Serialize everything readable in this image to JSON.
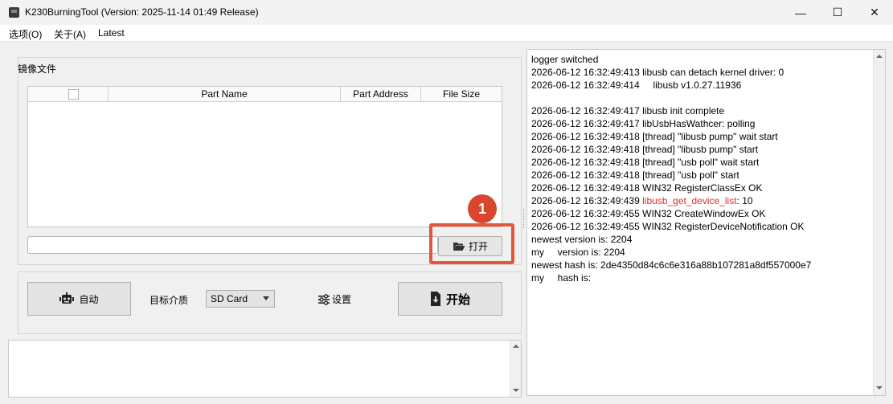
{
  "window": {
    "title": "K230BurningTool (Version: 2025-11-14 01:49 Release)",
    "minimize": "—",
    "maximize": "☐",
    "close": "✕"
  },
  "menu": [
    {
      "label": "选项(O)"
    },
    {
      "label": "关于(A)"
    },
    {
      "label": "Latest"
    }
  ],
  "image_group": {
    "title": "镜像文件",
    "columns": [
      "",
      "Part Name",
      "Part Address",
      "File Size"
    ],
    "path_value": "",
    "open_button": "打开",
    "annotation_number": "1"
  },
  "actions": {
    "auto_button": "自动",
    "target_label": "目标介质",
    "target_value": "SD Card",
    "settings_button": "设置",
    "start_button": "开始"
  },
  "log": [
    {
      "text": "logger switched"
    },
    {
      "text": "2026-06-12 16:32:49:413 libusb can detach kernel driver: 0"
    },
    {
      "text": "2026-06-12 16:32:49:414     libusb v1.0.27.11936"
    },
    {
      "text": ""
    },
    {
      "text": "2026-06-12 16:32:49:417 libusb init complete"
    },
    {
      "text": "2026-06-12 16:32:49:417 libUsbHasWathcer: polling"
    },
    {
      "text": "2026-06-12 16:32:49:418 [thread] \"libusb pump\" wait start"
    },
    {
      "text": "2026-06-12 16:32:49:418 [thread] \"libusb pump\" start"
    },
    {
      "text": "2026-06-12 16:32:49:418 [thread] \"usb poll\" wait start"
    },
    {
      "text": "2026-06-12 16:32:49:418 [thread] \"usb poll\" start"
    },
    {
      "text": "2026-06-12 16:32:49:418 WIN32 RegisterClassEx OK"
    },
    {
      "prefix": "2026-06-12 16:32:49:439 ",
      "error": "libusb_get_device_list",
      "suffix": ": 10"
    },
    {
      "text": "2026-06-12 16:32:49:455 WIN32 CreateWindowEx OK"
    },
    {
      "text": "2026-06-12 16:32:49:455 WIN32 RegisterDeviceNotification OK"
    },
    {
      "text": "newest version is: 2204"
    },
    {
      "text": "my     version is: 2204"
    },
    {
      "text": "newest hash is: 2de4350d84c6c6e316a88b107281a8df557000e7"
    },
    {
      "text": "my     hash is:"
    }
  ]
}
